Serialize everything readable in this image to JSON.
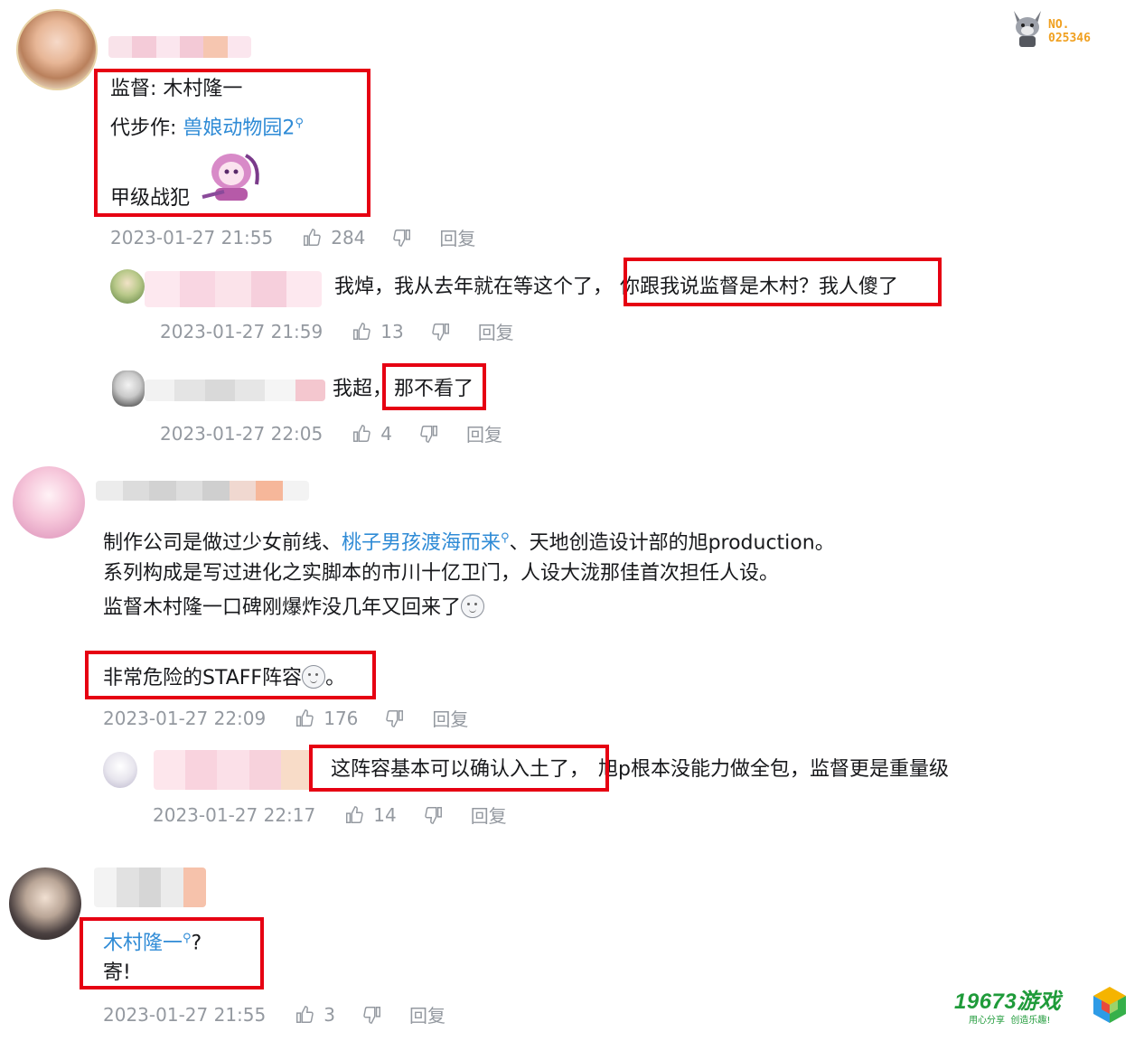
{
  "watermark": {
    "no_label": "NO.",
    "no_value": "025346"
  },
  "logo": {
    "brand": "19673游戏",
    "tagline": "用心分享  创造乐趣!"
  },
  "comments": [
    {
      "line1_label": "监督:",
      "line1_value": "木村隆一",
      "line2_label": "代步作:",
      "line2_link": "兽娘动物园2",
      "line3": "甲级战犯",
      "time": "2023-01-27 21:55",
      "likes": "284",
      "reply": "回复"
    },
    {
      "text_prefix": "我焯，我从去年就在等这个了，",
      "text_highlight": "你跟我说监督是木村？我人傻了",
      "time": "2023-01-27 21:59",
      "likes": "13",
      "reply": "回复"
    },
    {
      "text_prefix": "我超，",
      "text_highlight": "那不看了",
      "time": "2023-01-27 22:05",
      "likes": "4",
      "reply": "回复"
    },
    {
      "line1_a": "制作公司是做过少女前线、",
      "line1_link": "桃子男孩渡海而来",
      "line1_b": "、天地创造设计部的旭production。",
      "line2": "系列构成是写过进化之实脚本的市川十亿卫门，人设大泷那佳首次担任人设。",
      "line3": "监督木村隆一口碑刚爆炸没几年又回来了",
      "line4": "非常危险的STAFF阵容",
      "line4_end": "。",
      "time": "2023-01-27 22:09",
      "likes": "176",
      "reply": "回复"
    },
    {
      "text_highlight": "这阵容基本可以确认入土了，",
      "text_suffix": "旭p根本没能力做全包，监督更是重量级",
      "time": "2023-01-27 22:17",
      "likes": "14",
      "reply": "回复"
    },
    {
      "line1_link": "木村隆一",
      "line1_end": "?",
      "line2": "寄!",
      "time": "2023-01-27 21:55",
      "likes": "3",
      "reply": "回复"
    }
  ],
  "colors": {
    "link": "#2f8bd6",
    "highlight_box": "#e60012",
    "meta": "#9499a0"
  }
}
